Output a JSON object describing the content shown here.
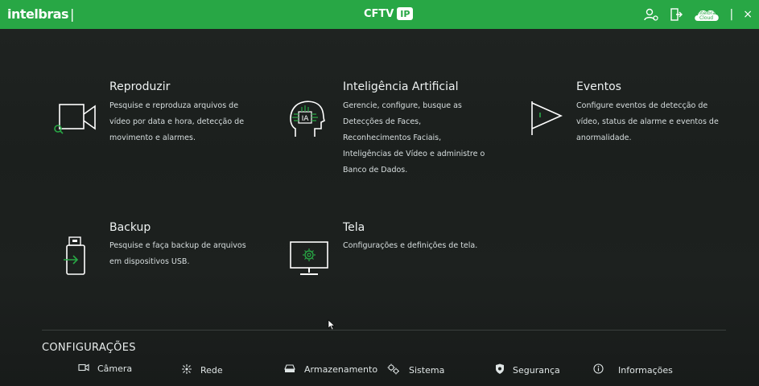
{
  "header": {
    "brand": "intelbras",
    "brand_separator": "|",
    "product": "CFTV",
    "product_badge": "IP",
    "cloud_label_line1": "Intelbras",
    "cloud_label_line2": "Cloud",
    "separator": "|",
    "icons": [
      "user-icon",
      "logout-icon",
      "cloud-icon",
      "close-icon"
    ],
    "close": "×"
  },
  "tiles": [
    {
      "title": "Reproduzir",
      "description": "Pesquise e reproduza arquivos de vídeo por data e hora, detecção de movimento e alarmes.",
      "icon": "playback-camera-icon"
    },
    {
      "title": "Inteligência Artificial",
      "description": "Gerencie, configure, busque as Detecções de Faces, Reconhecimentos Faciais, Inteligências de Vídeo e administre o Banco de Dados.",
      "icon": "ai-head-icon",
      "icon_text": "IA"
    },
    {
      "title": "Eventos",
      "description": "Configure eventos de detecção de vídeo, status de alarme e eventos de anormalidade.",
      "icon": "flag-icon"
    },
    {
      "title": "Backup",
      "description": "Pesquise e faça backup de arquivos em dispositivos USB.",
      "icon": "usb-icon"
    },
    {
      "title": "Tela",
      "description": "Configurações e definições de tela.",
      "icon": "monitor-icon"
    }
  ],
  "config": {
    "title": "CONFIGURAÇÕES",
    "items": [
      {
        "label": "Câmera",
        "icon": "camera-icon"
      },
      {
        "label": "Rede",
        "icon": "network-icon"
      },
      {
        "label": "Armazenamento",
        "icon": "storage-icon"
      },
      {
        "label": "Sistema",
        "icon": "gears-icon"
      },
      {
        "label": "Segurança",
        "icon": "shield-icon"
      },
      {
        "label": "Informações",
        "icon": "info-icon"
      }
    ]
  },
  "colors": {
    "accent": "#28a745",
    "background": "#1d211f",
    "text": "#e9eef0"
  }
}
